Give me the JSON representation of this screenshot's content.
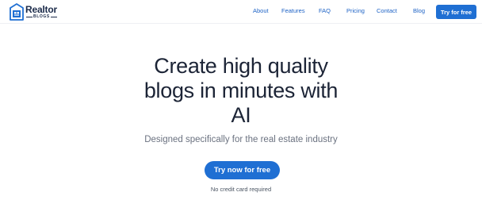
{
  "brand": {
    "name": "Realtor",
    "tagline": "BLOGS",
    "primary_color": "#1f6fd3",
    "text_color": "#1c2436"
  },
  "nav": {
    "links": [
      {
        "label": "About"
      },
      {
        "label": "Features"
      },
      {
        "label": "FAQ"
      },
      {
        "label": "Pricing"
      },
      {
        "label": "Contact"
      },
      {
        "label": "Blog"
      }
    ],
    "cta_label": "Try for free"
  },
  "hero": {
    "title_line1": "Create high quality",
    "title_line2": "blogs in minutes with",
    "title_line3": "AI",
    "subtitle": "Designed specifically for the real estate industry",
    "cta_label": "Try now for free",
    "note": "No credit card required"
  }
}
